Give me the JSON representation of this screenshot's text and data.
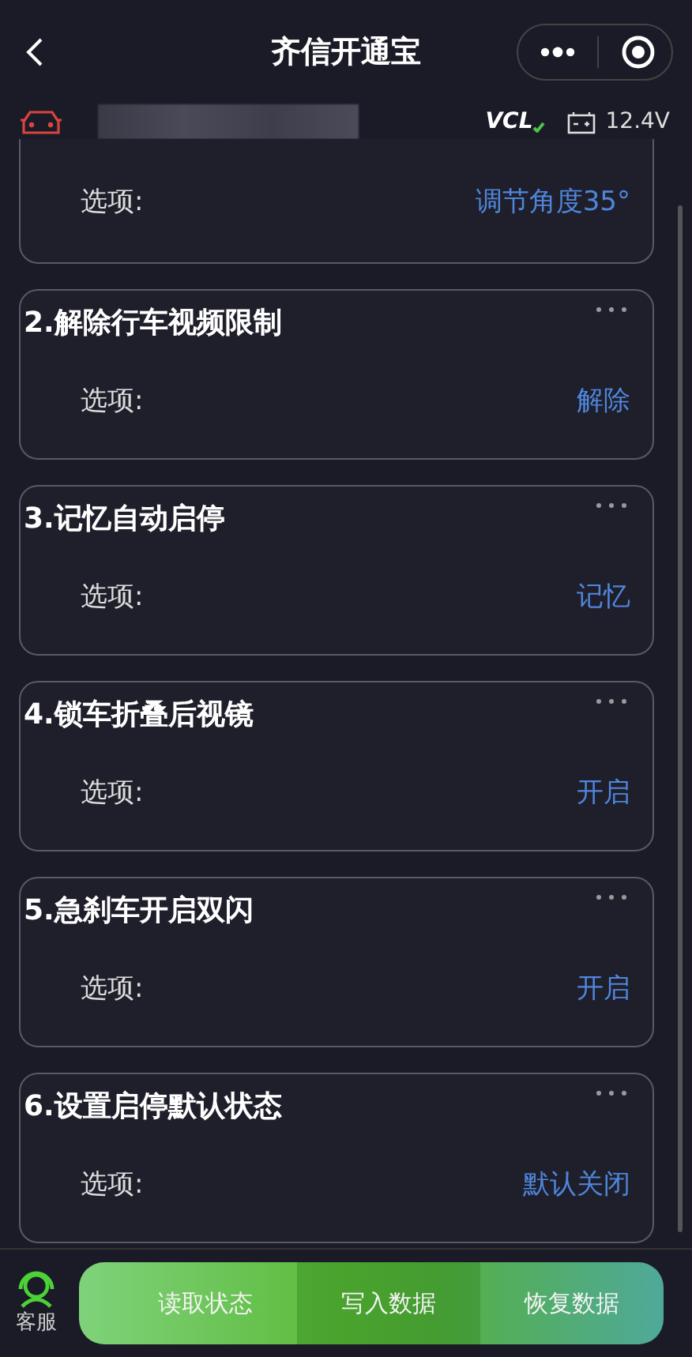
{
  "nav": {
    "title": "齐信开通宝"
  },
  "vehicle": {
    "vcl": "VCL",
    "voltage": "12.4V"
  },
  "items": [
    {
      "option_label": "选项:",
      "value": "调节角度35°"
    },
    {
      "title": "2.解除行车视频限制",
      "option_label": "选项:",
      "value": "解除"
    },
    {
      "title": "3.记忆自动启停",
      "option_label": "选项:",
      "value": "记忆"
    },
    {
      "title": "4.锁车折叠后视镜",
      "option_label": "选项:",
      "value": "开启"
    },
    {
      "title": "5.急刹车开启双闪",
      "option_label": "选项:",
      "value": "开启"
    },
    {
      "title": "6.设置启停默认状态",
      "option_label": "选项:",
      "value": "默认关闭"
    }
  ],
  "bottom": {
    "service": "客服",
    "actions": [
      {
        "label": "读取状态",
        "selected": false
      },
      {
        "label": "写入数据",
        "selected": true
      },
      {
        "label": "恢复数据",
        "selected": false
      }
    ]
  }
}
